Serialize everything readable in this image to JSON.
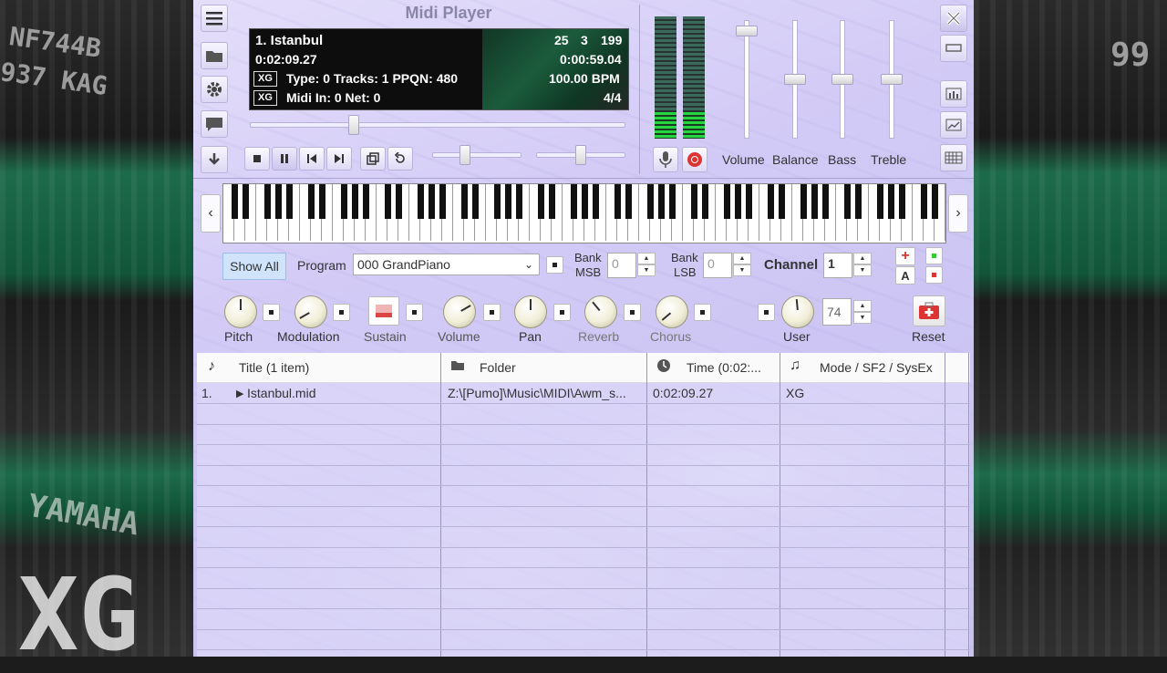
{
  "window": {
    "title": "Midi Player"
  },
  "background_text": {
    "top_left": "NF744B",
    "left_mid": "937 KAG",
    "bottom_left": "YAMAHA",
    "bottom_xg": "XG",
    "right_top": "99"
  },
  "left_toolbar": {
    "icons": [
      "menu-icon",
      "folder-icon",
      "settings-icon",
      "chat-icon",
      "download-icon"
    ]
  },
  "display": {
    "song": "1. Istanbul",
    "counter_a": "25",
    "counter_b": "3",
    "counter_c": "199",
    "elapsed": "0:02:09.27",
    "remaining": "0:00:59.04",
    "xg_badge": "XG",
    "type_info": "Type: 0 Tracks: 1 PPQN: 480",
    "bpm": "100.00 BPM",
    "midi_info": "Midi In: 0  Net: 0",
    "time_sig": "4/4"
  },
  "position_progress": 0.27,
  "tempo_level": 0.35,
  "pitch_level": 0.5,
  "mixer": {
    "labels": {
      "volume": "Volume",
      "balance": "Balance",
      "bass": "Bass",
      "treble": "Treble"
    },
    "volume": 0.95,
    "balance": 0.5,
    "bass": 0.5,
    "treble": 0.5
  },
  "vu_levels": [
    0.22,
    0.22
  ],
  "right_toolbar": {
    "icons": [
      "close-icon",
      "minimize-icon",
      "equalizer-icon",
      "chart-icon",
      "keyboard-grid-icon"
    ]
  },
  "controls": {
    "show_all": "Show All",
    "program_label": "Program",
    "program_value": "000 GrandPiano",
    "bank_msb_label_1": "Bank",
    "bank_msb_label_2": "MSB",
    "bank_msb_value": "0",
    "bank_lsb_label_1": "Bank",
    "bank_lsb_label_2": "LSB",
    "bank_lsb_value": "0",
    "channel_label": "Channel",
    "channel_value": "1",
    "a_label": "A"
  },
  "knobs": {
    "pitch": "Pitch",
    "modulation": "Modulation",
    "sustain": "Sustain",
    "volume": "Volume",
    "pan": "Pan",
    "reverb": "Reverb",
    "chorus": "Chorus",
    "user": "User",
    "user_value": "74",
    "reset": "Reset"
  },
  "playlist": {
    "headers": {
      "title": "Title (1 item)",
      "folder": "Folder",
      "time": "Time (0:02:...",
      "mode": "Mode / SF2 / SysEx"
    },
    "rows": [
      {
        "index": "1.",
        "title": "Istanbul.mid",
        "folder": "Z:\\[Pumo]\\Music\\MIDI\\Awm_s...",
        "time": "0:02:09.27",
        "mode": "XG"
      }
    ]
  }
}
